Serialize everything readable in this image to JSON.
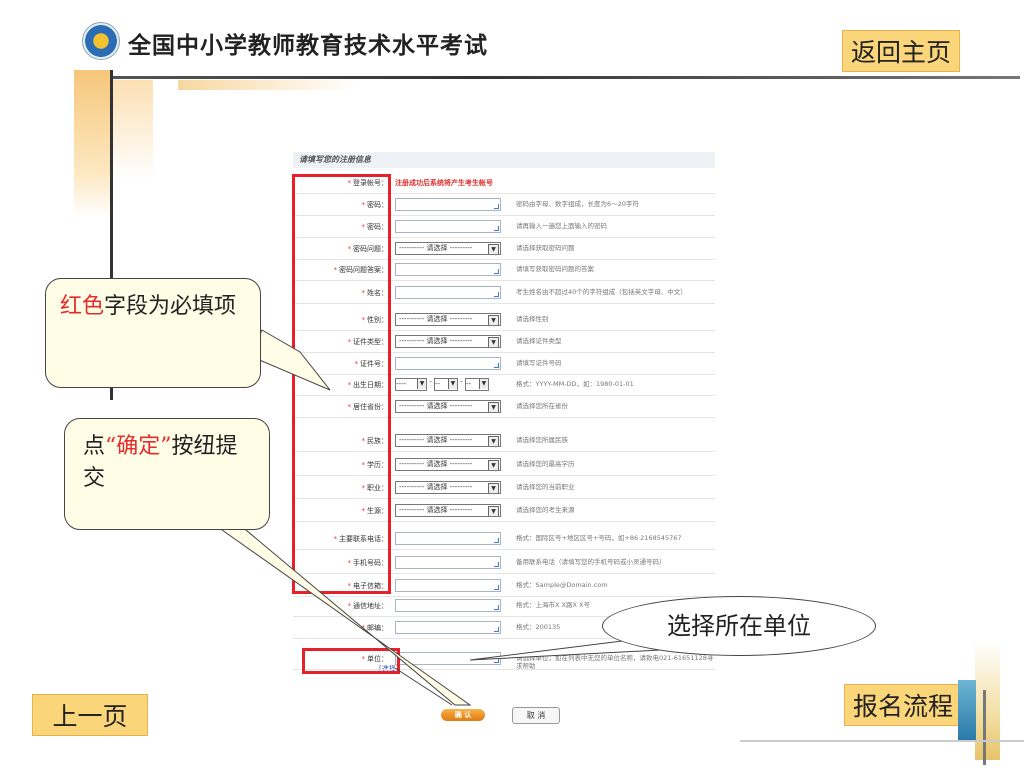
{
  "header": {
    "title": "全国中小学教师教育技术水平考试",
    "back_home": "返回主页"
  },
  "nav": {
    "prev_page": "上一页",
    "registration_flow": "报名流程"
  },
  "form": {
    "section_title": "请填写您的注册信息",
    "required_star": "*",
    "rows": [
      {
        "label": "登录帐号：",
        "note": "注册成功后系统将产生考生帐号"
      },
      {
        "label": "密码：",
        "tip": "密码由字母、数字组成，长度为6～20字符"
      },
      {
        "label": "密码：",
        "tip": "请再输入一遍您上面输入的密码"
      },
      {
        "label": "密码问题：",
        "select": "---------- 请选择 ---------",
        "tip": "请选择获取密码问题"
      },
      {
        "label": "密码问题答案：",
        "tip": "请填写获取密码问题的答案"
      },
      {
        "label": "姓名：",
        "tip": "考生姓名由不超过40个的字符组成（包括英文字母、中文）"
      },
      {
        "label": "性别：",
        "select": "---------- 请选择 ---------",
        "tip": "请选择性别"
      },
      {
        "label": "证件类型：",
        "select": "---------- 请选择 ---------",
        "tip": "请选择证件类型"
      },
      {
        "label": "证件号：",
        "tip": "请填写证件号码"
      },
      {
        "label": "出生日期：",
        "date": [
          "----",
          "--",
          "--"
        ],
        "tip": "格式：YYYY-MM-DD，如：1980-01-01"
      },
      {
        "label": "居住省份：",
        "select": "---------- 请选择 ---------",
        "tip": "请选择您所在省份"
      },
      {
        "label": "民族：",
        "select": "---------- 请选择 ---------",
        "tip": "请选择您所属民族"
      },
      {
        "label": "学历：",
        "select": "---------- 请选择 ---------",
        "tip": "请选择您的最高学历"
      },
      {
        "label": "职业：",
        "select": "---------- 请选择 ---------",
        "tip": "请选择您的当前职业"
      },
      {
        "label": "生源：",
        "select": "---------- 请选择 ---------",
        "tip": "请选择您的考生来源"
      },
      {
        "label": "主要联系电话：",
        "tip": "格式：国际区号+地区区号+号码，如+86 2168545767"
      },
      {
        "label": "手机号码：",
        "tip": "备用联系电话（请填写您的手机号码或小灵通号码）"
      },
      {
        "label": "电子信箱：",
        "tip": "格式：Sample@Domain.com"
      },
      {
        "label": "通信地址：",
        "tip": "格式：上海市X X路X X号"
      },
      {
        "label": "邮编：",
        "tip": "格式：200135"
      },
      {
        "label": "单位：",
        "tip": "请选择单位，如在列表中无您的单位名称，请致电021-61651128寻求帮助",
        "link": "[选择]"
      }
    ],
    "ok_button": "确 认",
    "cancel_button": "取 消"
  },
  "callouts": {
    "required_hl": "红色",
    "required_rest": "字段为必填项",
    "confirm_pre": "点",
    "confirm_hl": "“确定”",
    "confirm_post": "按纽提交",
    "select_unit": "选择所在单位"
  },
  "colors": {
    "accent_red": "#e8202a",
    "nav_button_bg": "#fbd57a"
  }
}
